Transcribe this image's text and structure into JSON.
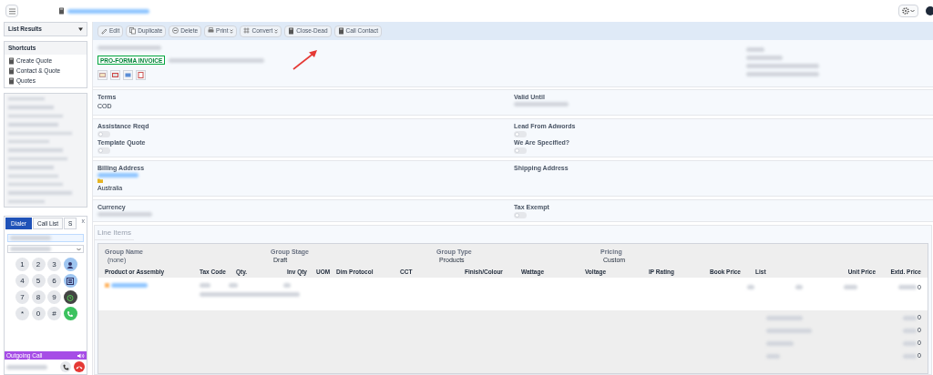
{
  "sidebar": {
    "list_results": {
      "label": "List Results",
      "expanded": false
    },
    "shortcuts": {
      "title": "Shortcuts",
      "items": [
        {
          "label": "Create Quote"
        },
        {
          "label": "Contact & Quote"
        },
        {
          "label": "Quotes"
        }
      ]
    }
  },
  "dialer": {
    "tabs": [
      {
        "label": "Dialer",
        "selected": true
      },
      {
        "label": "Call List",
        "selected": false
      },
      {
        "label": "S",
        "selected": false
      }
    ],
    "close": "x",
    "keys": [
      {
        "label": "1"
      },
      {
        "label": "2"
      },
      {
        "label": "3"
      },
      {
        "label": "4"
      },
      {
        "label": "5"
      },
      {
        "label": "6"
      },
      {
        "label": "7"
      },
      {
        "label": "8"
      },
      {
        "label": "9"
      },
      {
        "label": "*"
      },
      {
        "label": "0"
      },
      {
        "label": "#"
      }
    ],
    "side_buttons": [
      {
        "kind": "contact"
      },
      {
        "kind": "list"
      },
      {
        "kind": "alarm"
      },
      {
        "kind": "call"
      }
    ],
    "status": "Outgoing Call"
  },
  "toolbar": {
    "buttons": [
      {
        "label": "Edit",
        "has_menu": false
      },
      {
        "label": "Duplicate",
        "has_menu": false
      },
      {
        "label": "Delete",
        "has_menu": false
      },
      {
        "label": "Print",
        "has_menu": true
      },
      {
        "label": "Convert",
        "has_menu": true
      },
      {
        "label": "Close-Dead",
        "has_menu": false
      },
      {
        "label": "Call Contact",
        "has_menu": false
      }
    ]
  },
  "header": {
    "badge": "PRO-FORMA INVOICE"
  },
  "sections": [
    {
      "fields": [
        {
          "label": "Terms",
          "kind": "text",
          "value": "COD"
        },
        {
          "label": "Valid Until",
          "kind": "hidden"
        }
      ]
    },
    {
      "fields": [
        {
          "label": "Assistance Reqd",
          "kind": "toggle",
          "on": false
        },
        {
          "label": "Lead From Adwords",
          "kind": "toggle",
          "on": false
        },
        {
          "label": "Template Quote",
          "kind": "toggle",
          "on": false
        },
        {
          "label": "We Are Specified?",
          "kind": "toggle",
          "on": false
        }
      ]
    },
    {
      "fields": [
        {
          "label": "Billing Address",
          "kind": "address",
          "value": "Australia"
        },
        {
          "label": "Shipping Address",
          "kind": "empty"
        }
      ]
    },
    {
      "fields": [
        {
          "label": "Currency",
          "kind": "hidden"
        },
        {
          "label": "Tax Exempt",
          "kind": "toggle",
          "on": false
        }
      ]
    }
  ],
  "line_items": {
    "title": "Line Items",
    "group": [
      {
        "label": "Group Name",
        "value": "(none)"
      },
      {
        "label": "Group Stage",
        "value": "Draft"
      },
      {
        "label": "Group Type",
        "value": "Products"
      },
      {
        "label": "Pricing",
        "value": "Custom"
      }
    ],
    "columns": [
      "Product or Assembly",
      "Tax Code",
      "Qty.",
      "Inv Qty",
      "UOM",
      "Dim Protocol",
      "CCT",
      "Finish/Colour",
      "Wattage",
      "Voltage",
      "IP Rating",
      "Book Price",
      "List",
      "Unit Price",
      "Extd. Price"
    ],
    "row_total": "0",
    "totals": [
      "0",
      "0",
      "0",
      "0"
    ]
  }
}
